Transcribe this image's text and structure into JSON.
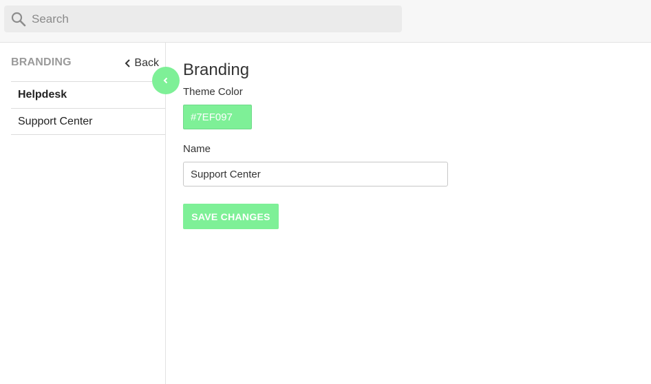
{
  "colors": {
    "accent": "#7EF097",
    "topbar_bg": "#f7f7f7",
    "search_bg": "#ebebeb"
  },
  "search": {
    "placeholder": "Search",
    "icon": "search-icon"
  },
  "sidebar": {
    "title": "BRANDING",
    "back_label": "Back",
    "back_icon": "chevron-left-icon",
    "items": [
      {
        "label": "Helpdesk",
        "active": true
      },
      {
        "label": "Support Center",
        "active": false
      }
    ],
    "collapse_icon": "chevron-left-icon"
  },
  "main": {
    "title": "Branding",
    "theme_color_label": "Theme Color",
    "theme_color_value": "#7EF097",
    "name_label": "Name",
    "name_value": "Support Center",
    "save_label": "SAVE CHANGES"
  }
}
